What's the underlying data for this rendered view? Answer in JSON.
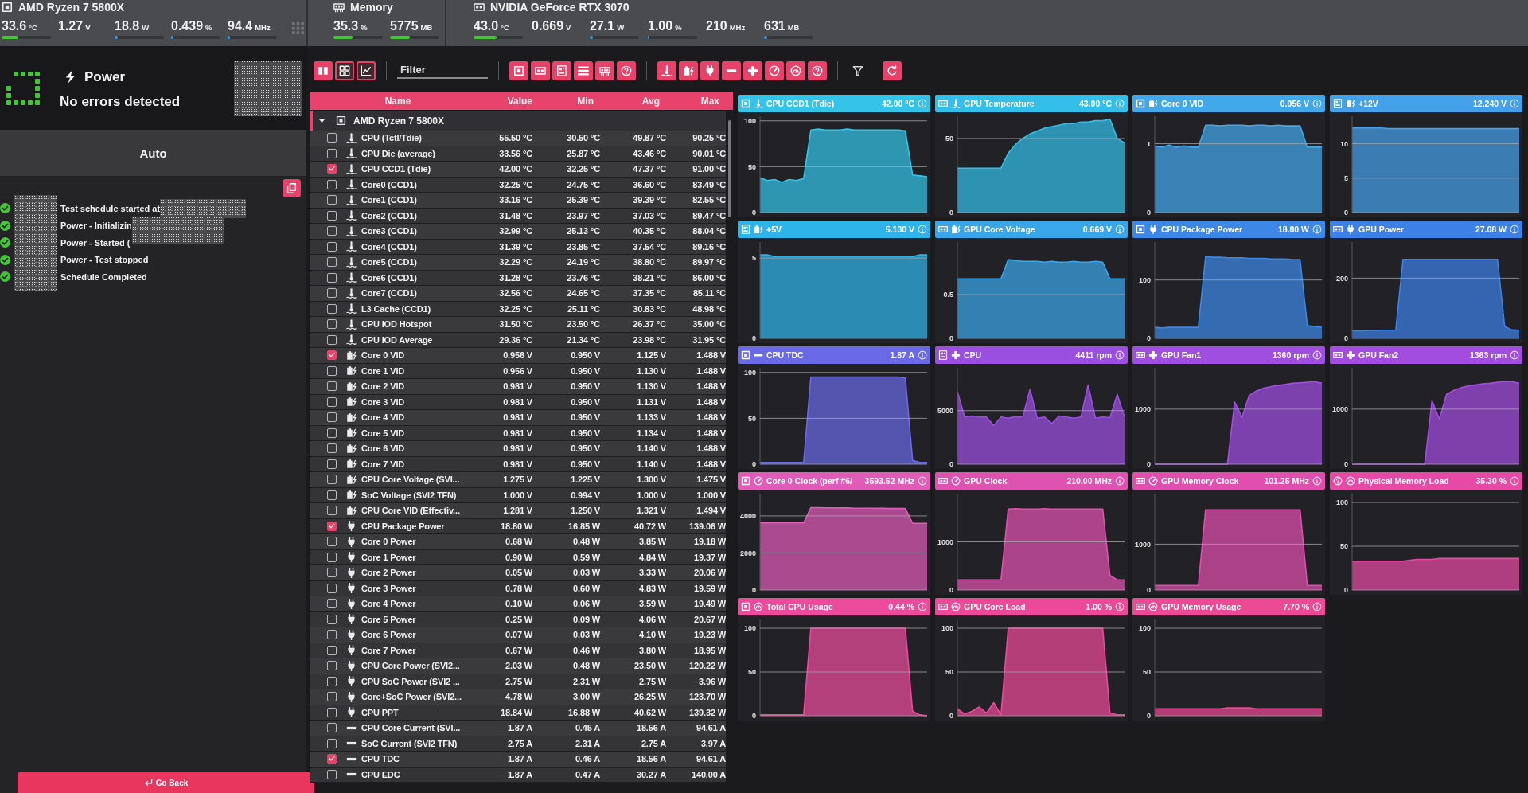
{
  "top_bar": {
    "groups": [
      {
        "kind": "cpu",
        "name": "AMD Ryzen 7 5800X",
        "readings": [
          {
            "value": "33.6",
            "unit": "°C",
            "level": 0.34,
            "color": "#49c23b"
          },
          {
            "value": "1.27",
            "unit": "V"
          },
          {
            "value": "18.8",
            "unit": "W",
            "level": 0.06,
            "color": "#3d9be0"
          },
          {
            "value": "0.439",
            "unit": "%",
            "level": 0.05,
            "color": "#3d9be0"
          },
          {
            "value": "94.4",
            "unit": "MHz",
            "level": 0.05,
            "color": "#3d9be0"
          }
        ]
      },
      {
        "kind": "memory",
        "name": "Memory",
        "readings": [
          {
            "value": "35.3",
            "unit": "%",
            "level": 0.38,
            "color": "#49c23b"
          },
          {
            "value": "5775",
            "unit": "MB",
            "level": 0.4,
            "color": "#49c23b"
          }
        ]
      },
      {
        "kind": "gpu",
        "name": "NVIDIA GeForce RTX 3070",
        "readings": [
          {
            "value": "43.0",
            "unit": "°C",
            "level": 0.47,
            "color": "#49c23b"
          },
          {
            "value": "0.669",
            "unit": "V"
          },
          {
            "value": "27.1",
            "unit": "W",
            "level": 0.06,
            "color": "#3d9be0"
          },
          {
            "value": "1.00",
            "unit": "%",
            "level": 0.04,
            "color": "#3d9be0"
          },
          {
            "value": "210",
            "unit": "MHz"
          },
          {
            "value": "631",
            "unit": "MB",
            "level": 0.06,
            "color": "#3d9be0"
          }
        ]
      }
    ]
  },
  "left_panel": {
    "status": {
      "test": "Power",
      "message": "No errors detected"
    },
    "mode": "Auto",
    "log": [
      "Test schedule started at",
      "Power - Initializin",
      "Power - Started (",
      "Power - Test stopped",
      "Schedule Completed"
    ],
    "back_button": "Go Back"
  },
  "toolbar": {
    "views": [
      {
        "selected": true
      },
      {
        "selected": false
      },
      {
        "selected": false
      }
    ],
    "filter": {
      "placeholder": "Filter"
    }
  },
  "table": {
    "columns": [
      "Name",
      "Value",
      "Min",
      "Avg",
      "Max"
    ],
    "groups": [
      {
        "kind": "cpu",
        "name": "AMD Ryzen 7 5800X",
        "expanded": true,
        "children": [
          {
            "kind": "temperature",
            "checked": false,
            "name": "CPU (Tctl/Tdie)",
            "value": "55.50 °C",
            "min": "30.50 °C",
            "avg": "49.87 °C",
            "max": "90.25 °C"
          },
          {
            "kind": "temperature",
            "checked": false,
            "name": "CPU Die (average)",
            "value": "33.56 °C",
            "min": "25.87 °C",
            "avg": "43.46 °C",
            "max": "90.01 °C"
          },
          {
            "kind": "temperature",
            "checked": true,
            "name": "CPU CCD1 (Tdie)",
            "value": "42.00 °C",
            "min": "32.25 °C",
            "avg": "47.37 °C",
            "max": "91.00 °C"
          },
          {
            "kind": "temperature",
            "checked": false,
            "name": "Core0 (CCD1)",
            "value": "32.25 °C",
            "min": "24.75 °C",
            "avg": "36.60 °C",
            "max": "83.49 °C"
          },
          {
            "kind": "temperature",
            "checked": false,
            "name": "Core1 (CCD1)",
            "value": "33.16 °C",
            "min": "25.39 °C",
            "avg": "39.39 °C",
            "max": "82.55 °C"
          },
          {
            "kind": "temperature",
            "checked": false,
            "name": "Core2 (CCD1)",
            "value": "31.48 °C",
            "min": "23.97 °C",
            "avg": "37.03 °C",
            "max": "89.47 °C"
          },
          {
            "kind": "temperature",
            "checked": false,
            "name": "Core3 (CCD1)",
            "value": "32.99 °C",
            "min": "25.13 °C",
            "avg": "40.35 °C",
            "max": "88.04 °C"
          },
          {
            "kind": "temperature",
            "checked": false,
            "name": "Core4 (CCD1)",
            "value": "31.39 °C",
            "min": "23.85 °C",
            "avg": "37.54 °C",
            "max": "89.16 °C"
          },
          {
            "kind": "temperature",
            "checked": false,
            "name": "Core5 (CCD1)",
            "value": "32.29 °C",
            "min": "24.19 °C",
            "avg": "38.80 °C",
            "max": "89.97 °C"
          },
          {
            "kind": "temperature",
            "checked": false,
            "name": "Core6 (CCD1)",
            "value": "31.28 °C",
            "min": "23.76 °C",
            "avg": "38.21 °C",
            "max": "86.00 °C"
          },
          {
            "kind": "temperature",
            "checked": false,
            "name": "Core7 (CCD1)",
            "value": "32.56 °C",
            "min": "24.65 °C",
            "avg": "37.35 °C",
            "max": "85.11 °C"
          },
          {
            "kind": "temperature",
            "checked": false,
            "name": "L3 Cache (CCD1)",
            "value": "32.25 °C",
            "min": "25.11 °C",
            "avg": "30.83 °C",
            "max": "48.98 °C"
          },
          {
            "kind": "temperature",
            "checked": false,
            "name": "CPU IOD Hotspot",
            "value": "31.50 °C",
            "min": "23.50 °C",
            "avg": "26.37 °C",
            "max": "35.00 °C"
          },
          {
            "kind": "temperature",
            "checked": false,
            "name": "CPU IOD Average",
            "value": "29.36 °C",
            "min": "21.34 °C",
            "avg": "23.98 °C",
            "max": "31.95 °C"
          },
          {
            "kind": "voltage",
            "checked": true,
            "name": "Core 0 VID",
            "value": "0.956 V",
            "min": "0.950 V",
            "avg": "1.125 V",
            "max": "1.488 V"
          },
          {
            "kind": "voltage",
            "checked": false,
            "name": "Core 1 VID",
            "value": "0.956 V",
            "min": "0.950 V",
            "avg": "1.130 V",
            "max": "1.488 V"
          },
          {
            "kind": "voltage",
            "checked": false,
            "name": "Core 2 VID",
            "value": "0.981 V",
            "min": "0.950 V",
            "avg": "1.130 V",
            "max": "1.488 V"
          },
          {
            "kind": "voltage",
            "checked": false,
            "name": "Core 3 VID",
            "value": "0.981 V",
            "min": "0.950 V",
            "avg": "1.131 V",
            "max": "1.488 V"
          },
          {
            "kind": "voltage",
            "checked": false,
            "name": "Core 4 VID",
            "value": "0.981 V",
            "min": "0.950 V",
            "avg": "1.133 V",
            "max": "1.488 V"
          },
          {
            "kind": "voltage",
            "checked": false,
            "name": "Core 5 VID",
            "value": "0.981 V",
            "min": "0.950 V",
            "avg": "1.134 V",
            "max": "1.488 V"
          },
          {
            "kind": "voltage",
            "checked": false,
            "name": "Core 6 VID",
            "value": "0.981 V",
            "min": "0.950 V",
            "avg": "1.140 V",
            "max": "1.488 V"
          },
          {
            "kind": "voltage",
            "checked": false,
            "name": "Core 7 VID",
            "value": "0.981 V",
            "min": "0.950 V",
            "avg": "1.140 V",
            "max": "1.488 V"
          },
          {
            "kind": "voltage",
            "checked": false,
            "name": "CPU Core Voltage (SVI...",
            "value": "1.275 V",
            "min": "1.225 V",
            "avg": "1.300 V",
            "max": "1.475 V"
          },
          {
            "kind": "voltage",
            "checked": false,
            "name": "SoC Voltage (SVI2 TFN)",
            "value": "1.000 V",
            "min": "0.994 V",
            "avg": "1.000 V",
            "max": "1.000 V"
          },
          {
            "kind": "voltage",
            "checked": false,
            "name": "CPU Core VID (Effectiv...",
            "value": "1.281 V",
            "min": "1.250 V",
            "avg": "1.321 V",
            "max": "1.494 V"
          },
          {
            "kind": "power",
            "checked": true,
            "name": "CPU Package Power",
            "value": "18.80 W",
            "min": "16.85 W",
            "avg": "40.72 W",
            "max": "139.06 W"
          },
          {
            "kind": "power",
            "checked": false,
            "name": "Core 0 Power",
            "value": "0.68 W",
            "min": "0.48 W",
            "avg": "3.85 W",
            "max": "19.18 W"
          },
          {
            "kind": "power",
            "checked": false,
            "name": "Core 1 Power",
            "value": "0.90 W",
            "min": "0.59 W",
            "avg": "4.84 W",
            "max": "19.37 W"
          },
          {
            "kind": "power",
            "checked": false,
            "name": "Core 2 Power",
            "value": "0.05 W",
            "min": "0.03 W",
            "avg": "3.33 W",
            "max": "20.06 W"
          },
          {
            "kind": "power",
            "checked": false,
            "name": "Core 3 Power",
            "value": "0.78 W",
            "min": "0.60 W",
            "avg": "4.83 W",
            "max": "19.59 W"
          },
          {
            "kind": "power",
            "checked": false,
            "name": "Core 4 Power",
            "value": "0.10 W",
            "min": "0.06 W",
            "avg": "3.59 W",
            "max": "19.49 W"
          },
          {
            "kind": "power",
            "checked": false,
            "name": "Core 5 Power",
            "value": "0.25 W",
            "min": "0.09 W",
            "avg": "4.06 W",
            "max": "20.67 W"
          },
          {
            "kind": "power",
            "checked": false,
            "name": "Core 6 Power",
            "value": "0.07 W",
            "min": "0.03 W",
            "avg": "4.10 W",
            "max": "19.23 W"
          },
          {
            "kind": "power",
            "checked": false,
            "name": "Core 7 Power",
            "value": "0.67 W",
            "min": "0.46 W",
            "avg": "3.80 W",
            "max": "18.95 W"
          },
          {
            "kind": "power",
            "checked": false,
            "name": "CPU Core Power (SVI2...",
            "value": "2.03 W",
            "min": "0.48 W",
            "avg": "23.50 W",
            "max": "120.22 W"
          },
          {
            "kind": "power",
            "checked": false,
            "name": "CPU SoC Power (SVI2 ...",
            "value": "2.75 W",
            "min": "2.31 W",
            "avg": "2.75 W",
            "max": "3.96 W"
          },
          {
            "kind": "power",
            "checked": false,
            "name": "Core+SoC Power (SVI2...",
            "value": "4.78 W",
            "min": "3.00 W",
            "avg": "26.25 W",
            "max": "123.70 W"
          },
          {
            "kind": "power",
            "checked": false,
            "name": "CPU PPT",
            "value": "18.84 W",
            "min": "16.88 W",
            "avg": "40.62 W",
            "max": "139.32 W"
          },
          {
            "kind": "current",
            "checked": false,
            "name": "CPU Core Current (SVI...",
            "value": "1.87 A",
            "min": "0.45 A",
            "avg": "18.56 A",
            "max": "94.61 A"
          },
          {
            "kind": "current",
            "checked": false,
            "name": "SoC Current (SVI2 TFN)",
            "value": "2.75 A",
            "min": "2.31 A",
            "avg": "2.75 A",
            "max": "3.97 A"
          },
          {
            "kind": "current",
            "checked": true,
            "name": "CPU TDC",
            "value": "1.87 A",
            "min": "0.46 A",
            "avg": "18.56 A",
            "max": "94.61 A"
          },
          {
            "kind": "current",
            "checked": false,
            "name": "CPU EDC",
            "value": "1.87 A",
            "min": "0.47 A",
            "avg": "30.27 A",
            "max": "140.00 A"
          }
        ]
      }
    ]
  },
  "charts": [
    {
      "kind": "cpu-temperature",
      "name": "CPU CCD1 (Tdie)",
      "value": "42.00 °C",
      "chart_data": {
        "type": "area",
        "color": "#35c4e8",
        "ylim": [
          0,
          105
        ],
        "yticks": [
          0,
          50,
          100
        ],
        "tick_labels": "y",
        "grid": true,
        "values": [
          38,
          35,
          36,
          33,
          36,
          35,
          37,
          90,
          91,
          90,
          90,
          90,
          91,
          90,
          90,
          90,
          90,
          90,
          90,
          90,
          89,
          41,
          40,
          39
        ]
      }
    },
    {
      "kind": "gpu-temperature",
      "name": "GPU Temperature",
      "value": "43.00 °C",
      "chart_data": {
        "type": "area",
        "color": "#33bfe9",
        "ylim": [
          0,
          65
        ],
        "yticks": [
          0,
          50
        ],
        "tick_labels": "y",
        "grid": true,
        "values": [
          30,
          30,
          30,
          30,
          30,
          30,
          30,
          40,
          46,
          50,
          53,
          55,
          57,
          58,
          59,
          60,
          60,
          61,
          61,
          62,
          62,
          63,
          50,
          47
        ]
      }
    },
    {
      "kind": "cpu-voltage",
      "name": "Core 0 VID",
      "value": "0.956 V",
      "chart_data": {
        "type": "area",
        "color": "#43a8ea",
        "ylim": [
          0,
          1.4
        ],
        "yticks": [
          0,
          1
        ],
        "tick_labels": "y",
        "grid": true,
        "values": [
          0.96,
          0.95,
          0.98,
          0.95,
          0.97,
          0.95,
          0.95,
          1.27,
          1.27,
          1.26,
          1.27,
          1.27,
          1.27,
          1.26,
          1.27,
          1.27,
          1.26,
          1.27,
          1.26,
          1.26,
          1.26,
          0.95,
          0.95,
          0.95
        ]
      }
    },
    {
      "kind": "board-voltage",
      "name": "+12V",
      "value": "12.240 V",
      "chart_data": {
        "type": "area",
        "color": "#45a0ea",
        "ylim": [
          0,
          14
        ],
        "yticks": [
          0,
          5,
          10
        ],
        "tick_labels": "y",
        "grid": true,
        "values": [
          12.3,
          12.3,
          12.3,
          12.3,
          12.3,
          12.2,
          12.2,
          12.2,
          12.2,
          12.2,
          12.2,
          12.2,
          12.2,
          12.2,
          12.2,
          12.2,
          12.2,
          12.2,
          12.2,
          12.2,
          12.2,
          12.2,
          12.2,
          12.2
        ]
      }
    },
    {
      "kind": "board-voltage",
      "name": "+5V",
      "value": "5.130 V",
      "chart_data": {
        "type": "area",
        "color": "#2fb4ea",
        "ylim": [
          0,
          6
        ],
        "yticks": [
          0,
          5
        ],
        "tick_labels": "y",
        "grid": true,
        "values": [
          5.2,
          5.2,
          5.1,
          5.1,
          5.1,
          5.1,
          5.1,
          5.1,
          5.1,
          5.1,
          5.1,
          5.1,
          5.1,
          5.1,
          5.1,
          5.1,
          5.1,
          5.1,
          5.1,
          5.1,
          5.1,
          5.1,
          5.2,
          5.2
        ]
      }
    },
    {
      "kind": "gpu-voltage",
      "name": "GPU Core Voltage",
      "value": "0.669 V",
      "chart_data": {
        "type": "area",
        "color": "#3aa6ea",
        "ylim": [
          0,
          1.1
        ],
        "yticks": [
          0,
          0.5
        ],
        "tick_labels": "y",
        "grid": true,
        "values": [
          0.68,
          0.68,
          0.68,
          0.68,
          0.68,
          0.68,
          0.68,
          0.9,
          0.89,
          0.88,
          0.88,
          0.88,
          0.87,
          0.88,
          0.87,
          0.87,
          0.88,
          0.87,
          0.87,
          0.88,
          0.87,
          0.68,
          0.68,
          0.68
        ]
      }
    },
    {
      "kind": "cpu-power",
      "name": "CPU Package Power",
      "value": "18.80 W",
      "chart_data": {
        "type": "area",
        "color": "#3d88e6",
        "ylim": [
          0,
          165
        ],
        "yticks": [
          0,
          100
        ],
        "tick_labels": "y",
        "grid": true,
        "values": [
          19,
          18,
          19,
          19,
          19,
          19,
          19,
          140,
          139,
          139,
          138,
          138,
          138,
          137,
          137,
          137,
          136,
          136,
          136,
          135,
          135,
          22,
          20,
          19
        ]
      }
    },
    {
      "kind": "gpu-power",
      "name": "GPU Power",
      "value": "27.08 W",
      "chart_data": {
        "type": "area",
        "color": "#3d80e6",
        "ylim": [
          0,
          320
        ],
        "yticks": [
          0,
          200
        ],
        "tick_labels": "y",
        "grid": true,
        "values": [
          25,
          25,
          26,
          26,
          27,
          27,
          27,
          262,
          262,
          262,
          262,
          262,
          262,
          262,
          262,
          262,
          262,
          262,
          262,
          262,
          262,
          40,
          28,
          27
        ]
      }
    },
    {
      "kind": "cpu-current",
      "name": "CPU TDC",
      "value": "1.87 A",
      "chart_data": {
        "type": "area",
        "color": "#6a6ae6",
        "ylim": [
          0,
          105
        ],
        "yticks": [
          0,
          50,
          100
        ],
        "tick_labels": "y",
        "grid": true,
        "values": [
          2,
          2,
          2,
          2,
          2,
          2,
          2,
          95,
          95,
          95,
          95,
          95,
          95,
          95,
          95,
          95,
          95,
          95,
          95,
          95,
          94,
          4,
          2,
          2
        ]
      }
    },
    {
      "kind": "board-fan",
      "name": "CPU",
      "value": "4411 rpm",
      "chart_data": {
        "type": "area",
        "color": "#9b4fe0",
        "ylim": [
          0,
          9000
        ],
        "yticks": [
          0,
          5000
        ],
        "tick_labels": "y",
        "grid": true,
        "values": [
          6800,
          4400,
          4500,
          4400,
          4400,
          3600,
          4400,
          4300,
          4450,
          4400,
          7000,
          4300,
          4400,
          3800,
          4500,
          4400,
          4300,
          4400,
          7400,
          4300,
          4400,
          4350,
          6500,
          4400
        ]
      }
    },
    {
      "kind": "gpu-fan",
      "name": "GPU Fan1",
      "value": "1360 rpm",
      "chart_data": {
        "type": "area",
        "color": "#a04ee0",
        "ylim": [
          0,
          1750
        ],
        "yticks": [
          0,
          1000
        ],
        "tick_labels": "y",
        "grid": true,
        "values": [
          0,
          0,
          0,
          0,
          0,
          0,
          0,
          0,
          0,
          0,
          0,
          1130,
          850,
          1250,
          1330,
          1380,
          1410,
          1430,
          1450,
          1470,
          1480,
          1490,
          1500,
          1470
        ]
      }
    },
    {
      "kind": "gpu-fan",
      "name": "GPU Fan2",
      "value": "1363 rpm",
      "chart_data": {
        "type": "area",
        "color": "#a24de0",
        "ylim": [
          0,
          1750
        ],
        "yticks": [
          0,
          1000
        ],
        "tick_labels": "y",
        "grid": true,
        "values": [
          0,
          0,
          0,
          0,
          0,
          0,
          0,
          0,
          0,
          0,
          0,
          1150,
          820,
          1270,
          1340,
          1390,
          1420,
          1440,
          1460,
          1470,
          1490,
          1500,
          1500,
          1470
        ]
      }
    },
    {
      "kind": "cpu-clock",
      "name": "Core 0 Clock (perf #6/",
      "value": "3593.52 MHz",
      "chart_data": {
        "type": "area",
        "color": "#e05cb8",
        "ylim": [
          0,
          5200
        ],
        "yticks": [
          0,
          2000,
          4000
        ],
        "tick_labels": "y",
        "grid": true,
        "values": [
          3620,
          3620,
          3620,
          3620,
          3620,
          3620,
          3620,
          4450,
          4450,
          4440,
          4440,
          4430,
          4430,
          4420,
          4420,
          4420,
          4410,
          4410,
          4400,
          4400,
          4400,
          3600,
          3600,
          3600
        ]
      }
    },
    {
      "kind": "gpu-clock",
      "name": "GPU Clock",
      "value": "210.00 MHz",
      "chart_data": {
        "type": "area",
        "color": "#e052b0",
        "ylim": [
          0,
          2000
        ],
        "yticks": [
          0,
          1000
        ],
        "tick_labels": "y",
        "grid": true,
        "values": [
          210,
          210,
          210,
          210,
          210,
          210,
          210,
          1680,
          1690,
          1680,
          1680,
          1680,
          1690,
          1680,
          1680,
          1680,
          1680,
          1680,
          1680,
          1680,
          1680,
          300,
          210,
          210
        ]
      }
    },
    {
      "kind": "gpu-clock",
      "name": "GPU Memory Clock",
      "value": "101.25 MHz",
      "chart_data": {
        "type": "area",
        "color": "#e04fae",
        "ylim": [
          0,
          2100
        ],
        "yticks": [
          0,
          1000
        ],
        "tick_labels": "y",
        "grid": true,
        "values": [
          100,
          100,
          100,
          100,
          100,
          100,
          100,
          1750,
          1750,
          1750,
          1750,
          1750,
          1750,
          1750,
          1750,
          1750,
          1750,
          1750,
          1750,
          1750,
          1750,
          100,
          100,
          100
        ]
      }
    },
    {
      "kind": "other-usage",
      "name": "Physical Memory Load",
      "value": "35.30 %",
      "chart_data": {
        "type": "area",
        "color": "#e64aa4",
        "ylim": [
          0,
          110
        ],
        "yticks": [
          0,
          50,
          100
        ],
        "tick_labels": "y",
        "grid": true,
        "values": [
          33,
          33,
          33,
          33,
          33,
          33,
          33,
          33,
          34,
          35,
          35,
          35,
          36,
          36,
          36,
          36,
          36,
          36,
          36,
          36,
          36,
          36,
          36,
          36
        ]
      }
    },
    {
      "kind": "cpu-usage",
      "name": "Total CPU Usage",
      "value": "0.44 %",
      "chart_data": {
        "type": "area",
        "color": "#ec4b9c",
        "ylim": [
          0,
          110
        ],
        "yticks": [
          0,
          50,
          100
        ],
        "tick_labels": "y",
        "grid": true,
        "values": [
          1,
          1,
          1,
          1,
          1,
          1,
          1,
          100,
          100,
          100,
          100,
          100,
          100,
          100,
          100,
          100,
          100,
          100,
          100,
          100,
          100,
          5,
          1,
          0
        ]
      }
    },
    {
      "kind": "gpu-usage",
      "name": "GPU Core Load",
      "value": "1.00 %",
      "chart_data": {
        "type": "area",
        "color": "#ec4a98",
        "ylim": [
          0,
          110
        ],
        "yticks": [
          0,
          50,
          100
        ],
        "tick_labels": "y",
        "grid": true,
        "values": [
          8,
          2,
          5,
          10,
          3,
          15,
          1,
          100,
          100,
          100,
          100,
          100,
          100,
          100,
          100,
          100,
          100,
          100,
          100,
          100,
          100,
          3,
          1,
          1
        ]
      }
    },
    {
      "kind": "gpu-usage",
      "name": "GPU Memory Usage",
      "value": "7.70 %",
      "chart_data": {
        "type": "area",
        "color": "#ec4a94",
        "ylim": [
          0,
          110
        ],
        "yticks": [
          0,
          50,
          100
        ],
        "tick_labels": "y",
        "grid": true,
        "values": [
          8,
          8,
          8,
          8,
          8,
          8,
          8,
          8,
          8,
          8,
          9,
          9,
          9,
          9,
          8,
          8,
          8,
          8,
          8,
          8,
          8,
          8,
          8,
          8
        ]
      }
    }
  ]
}
